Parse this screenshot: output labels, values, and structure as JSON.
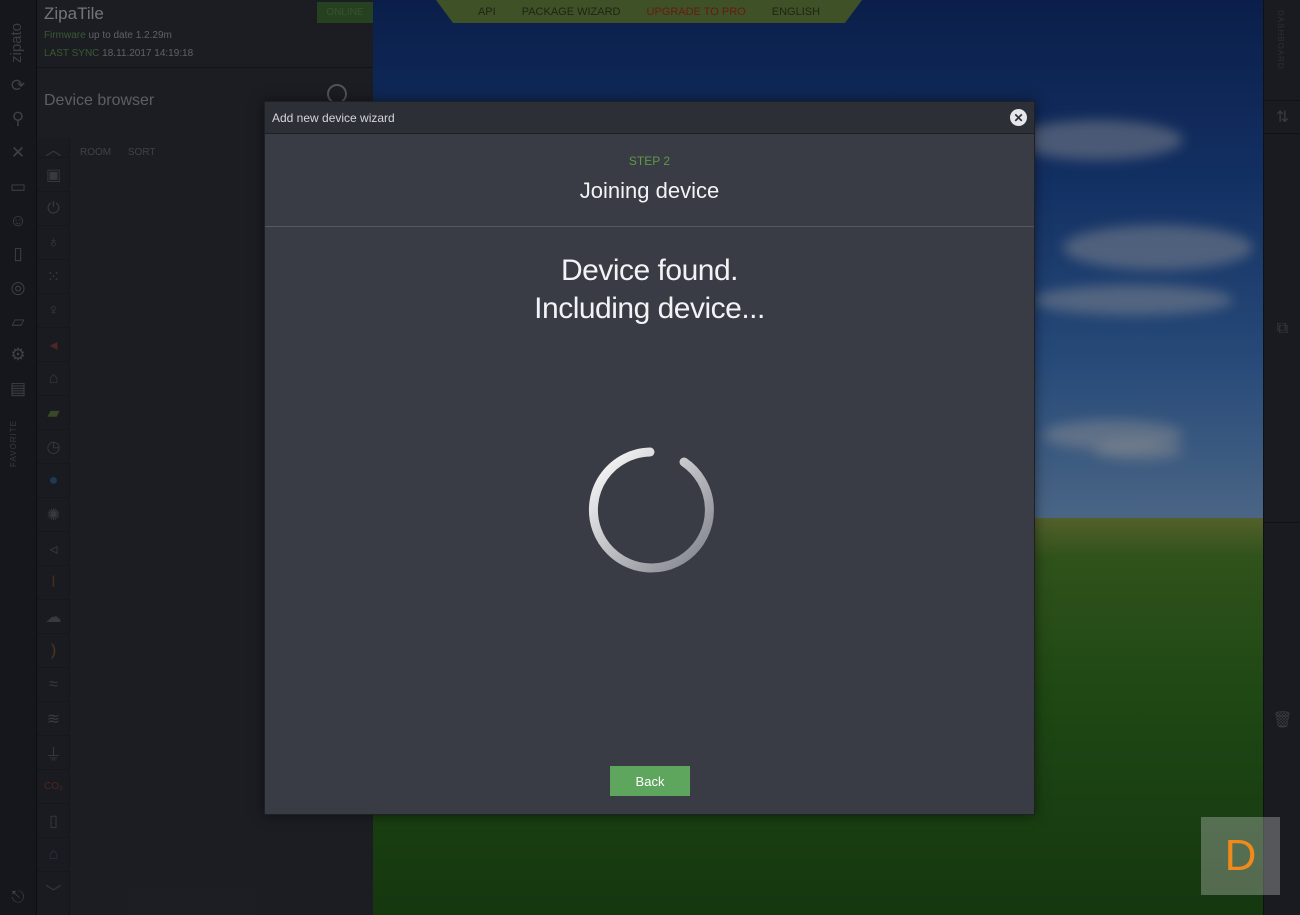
{
  "header": {
    "app_title": "ZipaTile",
    "status_badge": "ONLINE",
    "firmware_label": "Firmware",
    "firmware_status": " up to date 1.2.29m",
    "last_sync_label": "LAST SYNC",
    "last_sync_value": " 18.11.2017 14:19:18"
  },
  "rail": {
    "logo_text": "zipato",
    "favorite_label": "FAVORITE",
    "icons": [
      "sync-icon",
      "search-icon",
      "network-icon",
      "scenes-icon",
      "users-icon",
      "device-icon",
      "dashboard-icon",
      "folder-icon",
      "gear-icon",
      "notes-icon"
    ]
  },
  "device_browser": {
    "title": "Device browser",
    "filters": [
      "ROOM",
      "SORT"
    ],
    "category_icons": [
      "window-icon",
      "power-icon",
      "bulb-icon",
      "grid-icon",
      "bulb-small-icon",
      "speaker-red-icon",
      "sensor-icon",
      "camera-icon",
      "clock-icon",
      "water-drop-icon",
      "gear-small-icon",
      "volume-icon",
      "thermometer-icon",
      "weather-icon",
      "signal-icon",
      "wind-icon",
      "meter-icon",
      "plug-icon",
      "co2-icon",
      "tablet-icon",
      "home-icon",
      "chevron-down-icon"
    ]
  },
  "topmenu": {
    "api": "API",
    "package_wizard": "PACKAGE WIZARD",
    "upgrade": "UPGRADE TO PRO",
    "language": "ENGLISH"
  },
  "right_rail": {
    "vertical_text": "DASHBOARD"
  },
  "modal": {
    "title": "Add new device wizard",
    "step_label": "STEP 2",
    "step_title": "Joining device",
    "status_line1": "Device found.",
    "status_line2": "Including device...",
    "back_label": "Back"
  },
  "corner_tile": {
    "letter": "D"
  },
  "colors": {
    "accent_green": "#5e9a47",
    "button_green": "#5ea55e",
    "modal_bg": "#393b45",
    "upgrade_red": "#b02a16",
    "tile_orange": "#f08a1a"
  }
}
